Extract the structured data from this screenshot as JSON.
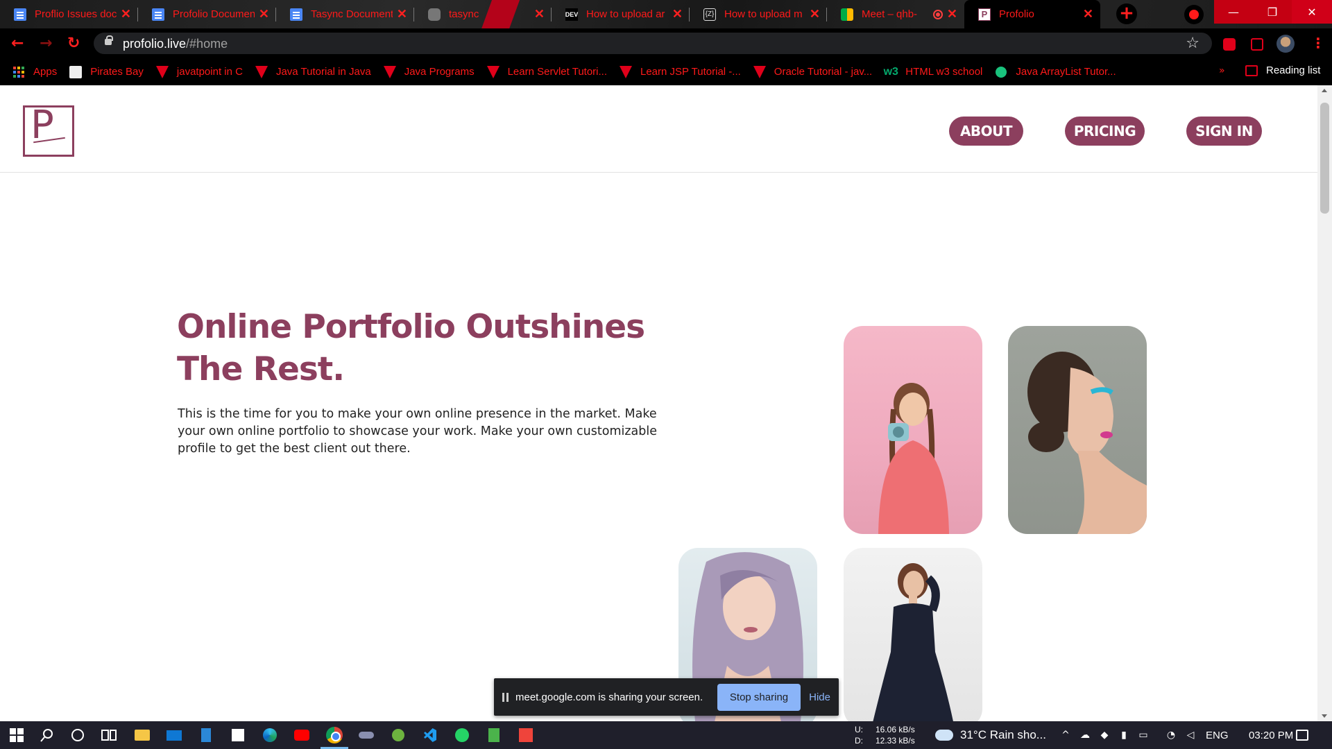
{
  "browser": {
    "tabs": [
      {
        "title": "Proflio Issues doc",
        "icon": "google-docs-icon"
      },
      {
        "title": "Profolio Documen",
        "icon": "google-docs-icon"
      },
      {
        "title": "Tasync Document",
        "icon": "google-docs-icon"
      },
      {
        "title": "tasync",
        "icon": "ghost-icon"
      },
      {
        "title": "How to upload ar",
        "icon": "dev-icon",
        "icon_text": "DEV"
      },
      {
        "title": "How to upload m",
        "icon": "z-icon",
        "icon_text": "{Z}"
      },
      {
        "title": "Meet – qhb-",
        "icon": "google-meet-icon"
      },
      {
        "title": "Profolio",
        "icon": "profolio-icon",
        "icon_text": "P",
        "active": true
      }
    ],
    "new_tab_symbol": "+",
    "close_symbol": "✕",
    "window_controls": {
      "minimize": "—",
      "maximize": "❐",
      "close": "✕"
    },
    "url_host": "profolio.live",
    "url_path": "/#home",
    "nav": {
      "back": "←",
      "forward": "→",
      "reload": "↻"
    },
    "star_symbol": "☆",
    "kebab_symbol": "⋮",
    "bookmarks": [
      {
        "label": "Apps",
        "icon": "apps-grid-icon"
      },
      {
        "label": "Pirates Bay",
        "icon": "pirate-ship-icon"
      },
      {
        "label": "javatpoint in C",
        "icon": "javatpoint-icon"
      },
      {
        "label": "Java Tutorial in Java",
        "icon": "javatpoint-icon"
      },
      {
        "label": "Java Programs",
        "icon": "javatpoint-icon"
      },
      {
        "label": "Learn Servlet Tutori...",
        "icon": "javatpoint-icon"
      },
      {
        "label": "Learn JSP Tutorial -...",
        "icon": "javatpoint-icon"
      },
      {
        "label": "Oracle Tutorial - jav...",
        "icon": "javatpoint-icon"
      },
      {
        "label": "HTML w3 school",
        "icon": "w3schools-icon",
        "icon_text": "w3"
      },
      {
        "label": "Java ArrayList Tutor...",
        "icon": "green-circle-icon"
      }
    ],
    "bookmarks_more": "»",
    "reading_list": "Reading list"
  },
  "site": {
    "nav": {
      "about": "ABOUT",
      "pricing": "PRICING",
      "sign_in": "SIGN IN"
    },
    "logo_letter": "P",
    "hero": {
      "title": "Online Portfolio Outshines The Rest.",
      "text": "This is the time for you to make your own online presence in the market. Make your own online portfolio to showcase your work. Make your own customizable profile to get the best client out there."
    }
  },
  "screen_share": {
    "message": "meet.google.com is sharing your screen.",
    "stop_label": "Stop sharing",
    "hide_label": "Hide"
  },
  "taskbar": {
    "net_upload_label": "U:",
    "net_download_label": "D:",
    "net_upload": "16.06 kB/s",
    "net_download": "12.33 kB/s",
    "weather": "31°C  Rain sho...",
    "language": "ENG",
    "time": "03:20 PM"
  },
  "colors": {
    "brand": "#8c3f5e",
    "browser_accent": "#ff1a1a",
    "share_button": "#8ab4f8"
  }
}
